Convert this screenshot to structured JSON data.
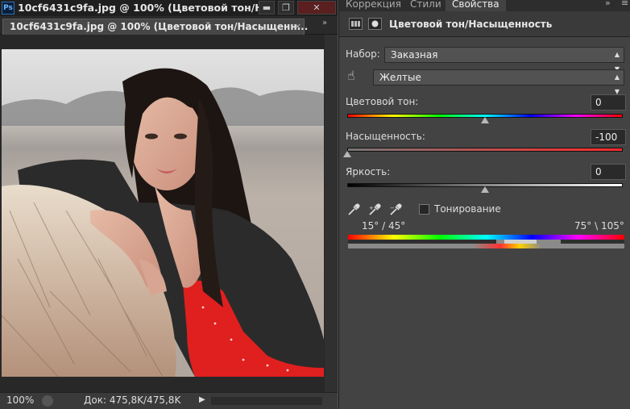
{
  "document_window": {
    "app_badge": "Ps",
    "title": "10cf6431c9fa.jpg @ 100% (Цветовой тон/Н...",
    "tab_label": "10cf6431c9fa.jpg @ 100% (Цветовой тон/Насыщенн...",
    "tab_close": "×",
    "expand_glyph": "»",
    "status": {
      "zoom": "100%",
      "doc_info": "Док: 475,8K/475,8K",
      "arrow": "▶"
    }
  },
  "window_controls": {
    "minimize": "▬",
    "maximize": "❐",
    "close": "✕"
  },
  "panel": {
    "tabs": [
      {
        "label": "Коррекция",
        "active": false
      },
      {
        "label": "Стили",
        "active": false
      },
      {
        "label": "Свойства",
        "active": true
      }
    ],
    "menu_glyph": "»",
    "close_glyph": "≡",
    "title": "Цветовой тон/Насыщенность",
    "preset_label": "Набор:",
    "preset_value": "Заказная",
    "channel_value": "Желтые",
    "hue": {
      "label": "Цветовой тон:",
      "value": "0",
      "fraction": 0.5
    },
    "saturation": {
      "label": "Насыщенность:",
      "value": "-100",
      "fraction": 0.0
    },
    "lightness": {
      "label": "Яркость:",
      "value": "0",
      "fraction": 0.5
    },
    "colorize_label": "Тонирование",
    "range_left": "15° / 45°",
    "range_right": "75° \\ 105°"
  },
  "colors": {
    "panel_bg": "#434343",
    "accent_red": "#ff2a2a"
  }
}
